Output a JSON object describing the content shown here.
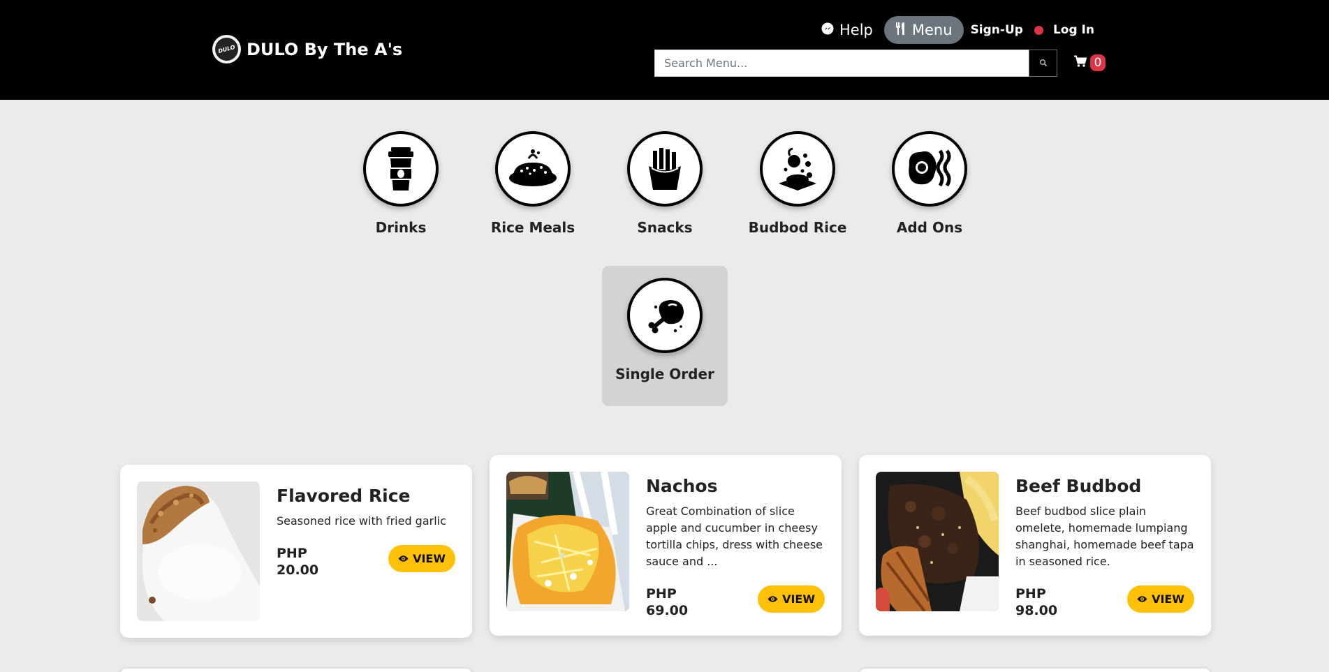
{
  "header": {
    "brand_logo_text": "DULO",
    "brand_name": "DULO By The A's",
    "nav": {
      "help_label": "Help",
      "menu_label": "Menu",
      "signup_label": "Sign-Up",
      "login_label": "Log In"
    },
    "search": {
      "placeholder": "Search Menu..."
    },
    "cart_count": "0"
  },
  "categories": [
    {
      "label": "Drinks",
      "icon": "coffee-cup-icon"
    },
    {
      "label": "Rice Meals",
      "icon": "rice-bowl-icon"
    },
    {
      "label": "Snacks",
      "icon": "fries-icon"
    },
    {
      "label": "Budbod Rice",
      "icon": "budbod-rice-icon"
    },
    {
      "label": "Add Ons",
      "icon": "egg-bacon-icon"
    },
    {
      "label": "Single Order",
      "icon": "chicken-leg-icon",
      "selected": true
    }
  ],
  "products": [
    {
      "name": "Flavored Rice",
      "description": "Seasoned rice with fried garlic",
      "price": "PHP\n20.00",
      "view_label": "VIEW",
      "image": "garlic-rice-photo"
    },
    {
      "name": "Nachos",
      "description": "Great Combination of slice apple and cucumber in cheesy tortilla chips, dress with cheese sauce and ...",
      "price": "PHP\n69.00",
      "view_label": "VIEW",
      "image": "nachos-photo"
    },
    {
      "name": "Beef Budbod",
      "description": "Beef budbod slice plain omelete, homemade lumpiang shanghai, homemade beef tapa in seasoned rice.",
      "price": "PHP\n98.00",
      "view_label": "VIEW",
      "image": "beef-budbod-photo"
    }
  ],
  "colors": {
    "header_bg": "#000000",
    "page_bg": "#ebebeb",
    "accent_yellow": "#ffc107",
    "badge_red": "#dc3545",
    "active_nav_gray": "#6c757d"
  }
}
